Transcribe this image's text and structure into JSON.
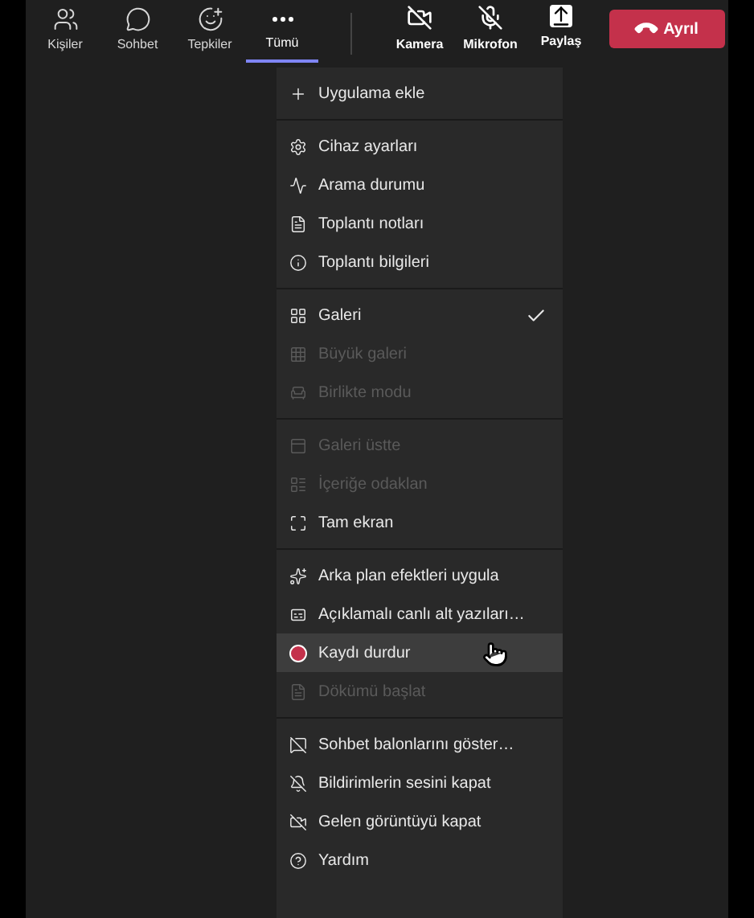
{
  "toolbar": {
    "items": [
      {
        "label": "Kişiler",
        "selected": false
      },
      {
        "label": "Sohbet",
        "selected": false
      },
      {
        "label": "Tepkiler",
        "selected": false
      },
      {
        "label": "Tümü",
        "selected": true
      }
    ],
    "devices": [
      {
        "label": "Kamera",
        "on": false
      },
      {
        "label": "Mikrofon",
        "on": false
      },
      {
        "label": "Paylaş",
        "on": true
      }
    ],
    "leave_button": "Ayrıl"
  },
  "menu": {
    "sections": [
      [
        {
          "label": "Uygulama ekle",
          "disabled": false,
          "checked": false,
          "highlighted": false
        }
      ],
      [
        {
          "label": "Cihaz ayarları",
          "disabled": false,
          "checked": false,
          "highlighted": false
        },
        {
          "label": "Arama durumu",
          "disabled": false,
          "checked": false,
          "highlighted": false
        },
        {
          "label": "Toplantı notları",
          "disabled": false,
          "checked": false,
          "highlighted": false
        },
        {
          "label": "Toplantı bilgileri",
          "disabled": false,
          "checked": false,
          "highlighted": false
        }
      ],
      [
        {
          "label": "Galeri",
          "disabled": false,
          "checked": true,
          "highlighted": false
        },
        {
          "label": "Büyük galeri",
          "disabled": true,
          "checked": false,
          "highlighted": false
        },
        {
          "label": "Birlikte modu",
          "disabled": true,
          "checked": false,
          "highlighted": false
        }
      ],
      [
        {
          "label": "Galeri üstte",
          "disabled": true,
          "checked": false,
          "highlighted": false
        },
        {
          "label": "İçeriğe odaklan",
          "disabled": true,
          "checked": false,
          "highlighted": false
        },
        {
          "label": "Tam ekran",
          "disabled": false,
          "checked": false,
          "highlighted": false
        }
      ],
      [
        {
          "label": "Arka plan efektleri uygula",
          "disabled": false,
          "checked": false,
          "highlighted": false
        },
        {
          "label": "Açıklamalı canlı alt yazıları…",
          "disabled": false,
          "checked": false,
          "highlighted": false
        },
        {
          "label": "Kaydı durdur",
          "disabled": false,
          "checked": false,
          "highlighted": true
        },
        {
          "label": "Dökümü başlat",
          "disabled": true,
          "checked": false,
          "highlighted": false
        }
      ],
      [
        {
          "label": "Sohbet balonlarını göster…",
          "disabled": false,
          "checked": false,
          "highlighted": false
        },
        {
          "label": "Bildirimlerin sesini kapat",
          "disabled": false,
          "checked": false,
          "highlighted": false
        },
        {
          "label": "Gelen görüntüyü kapat",
          "disabled": false,
          "checked": false,
          "highlighted": false
        },
        {
          "label": "Yardım",
          "disabled": false,
          "checked": false,
          "highlighted": false
        }
      ]
    ]
  }
}
